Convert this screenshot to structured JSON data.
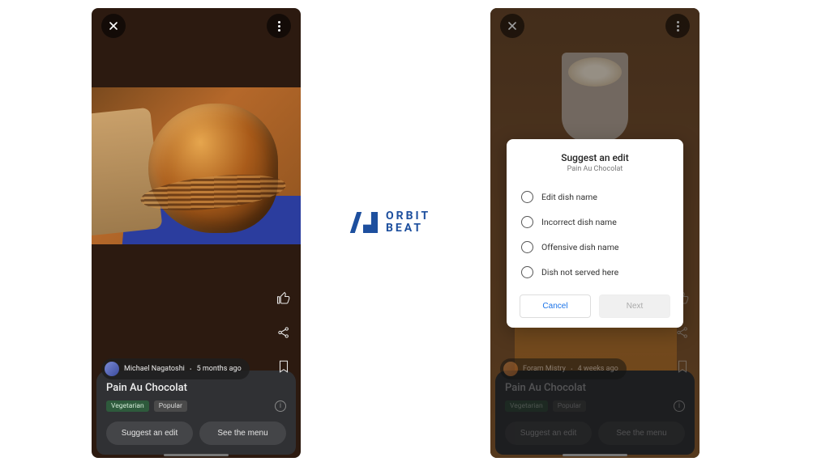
{
  "logo": {
    "line1": "ORBIT",
    "line2": "BEAT"
  },
  "left": {
    "author": "Michael Nagatoshi",
    "age": "5 months ago",
    "dish": "Pain Au Chocolat",
    "tags": {
      "veg": "Vegetarian",
      "pop": "Popular"
    },
    "buttons": {
      "edit": "Suggest an edit",
      "menu": "See the menu"
    }
  },
  "right": {
    "author": "Foram Mistry",
    "age": "4 weeks ago",
    "dish": "Pain Au Chocolat",
    "tags": {
      "veg": "Vegetarian",
      "pop": "Popular"
    },
    "buttons": {
      "edit": "Suggest an edit",
      "menu": "See the menu"
    },
    "dialog": {
      "title": "Suggest an edit",
      "subtitle": "Pain Au Chocolat",
      "options": [
        "Edit dish name",
        "Incorrect dish name",
        "Offensive dish name",
        "Dish not served here"
      ],
      "cancel": "Cancel",
      "next": "Next"
    }
  }
}
